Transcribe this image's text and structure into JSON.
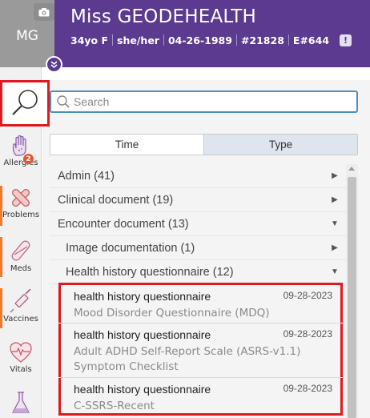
{
  "patient": {
    "initials": "MG",
    "name": "Miss GEODEHEALTH",
    "age_sex": "34yo F",
    "pronouns": "she/her",
    "dob": "04-26-1989",
    "mrn": "#21828",
    "encounter": "E#644",
    "alert_glyph": "!"
  },
  "rail": {
    "items": [
      {
        "label": "Allergies",
        "icon": "hand-icon",
        "badge": "2"
      },
      {
        "label": "Problems",
        "icon": "bandage-icon"
      },
      {
        "label": "Meds",
        "icon": "pill-icon"
      },
      {
        "label": "Vaccines",
        "icon": "syringe-icon"
      },
      {
        "label": "Vitals",
        "icon": "heart-pulse-icon"
      }
    ]
  },
  "search": {
    "placeholder": "Search",
    "value": ""
  },
  "toggle": {
    "left": "Time",
    "right": "Type",
    "selected": "Type"
  },
  "categories": [
    {
      "label": "Admin (41)",
      "expanded": false
    },
    {
      "label": "Clinical document (19)",
      "expanded": false
    },
    {
      "label": "Encounter document (13)",
      "expanded": true
    },
    {
      "label": "Image documentation (1)",
      "expanded": false
    },
    {
      "label": "Health history questionnaire (12)",
      "expanded": true
    }
  ],
  "documents": [
    {
      "title": "health history questionnaire",
      "date": "09-28-2023",
      "subtitle": "Mood Disorder Questionnaire (MDQ)"
    },
    {
      "title": "health history questionnaire",
      "date": "09-28-2023",
      "subtitle": "Adult ADHD Self-Report Scale (ASRS-v1.1) Symptom Checklist"
    },
    {
      "title": "health history questionnaire",
      "date": "09-28-2023",
      "subtitle": "C-SSRS-Recent"
    }
  ],
  "colors": {
    "header": "#5b3a8f",
    "highlight": "#e0181f",
    "search_border": "#4d8fc4",
    "rail_accent": "#f07a2a"
  }
}
